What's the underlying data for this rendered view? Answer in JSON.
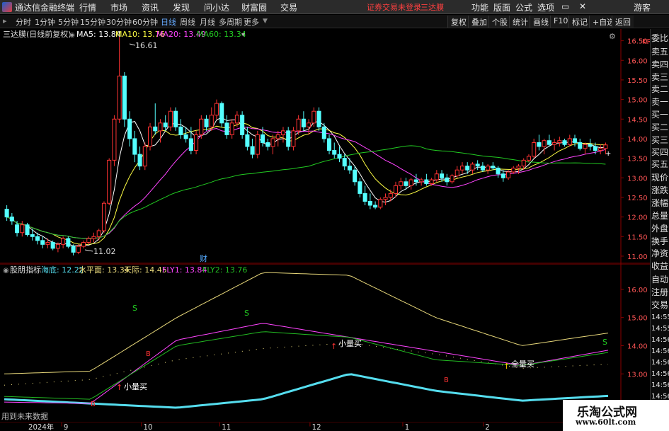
{
  "colors": {
    "up": "#ff3333",
    "down": "#55ffff",
    "ma5": "#ffffff",
    "ma10": "#ffff44",
    "ma20": "#ff44ff",
    "ma60": "#22cc22",
    "fly2": "#22bb22",
    "fly1": "#ff44ff",
    "ceiling": "#e8d87a",
    "floor": "#55ddee"
  },
  "topbar": {
    "app": "通达信金融终端",
    "menus": [
      "行情",
      "市场",
      "资讯",
      "发现",
      "问小达",
      "财富圈",
      "交易"
    ],
    "notice": "证券交易未登录",
    "stock": "三达膜",
    "right": [
      "功能",
      "版面",
      "公式",
      "选项"
    ],
    "guest": "游客"
  },
  "periods": {
    "items": [
      "分时",
      "1分钟",
      "5分钟",
      "15分钟",
      "30分钟",
      "60分钟",
      "日线",
      "周线",
      "月线",
      "多周期",
      "更多"
    ],
    "active": "日线",
    "right": [
      "复权",
      "叠加",
      "个股",
      "统计",
      "画线",
      "F10",
      "标记",
      "+自选",
      "返回"
    ]
  },
  "main": {
    "title": "三达膜(日线前复权)",
    "legend": [
      {
        "label": "MA5: 13.84",
        "key": "ma5"
      },
      {
        "label": "MA10: 13.76",
        "key": "ma10"
      },
      {
        "label": "MA20: 13.49",
        "key": "ma20"
      },
      {
        "label": "MA60: 13.34",
        "key": "ma60"
      }
    ],
    "max_label": "16.61",
    "min_label": "11.02",
    "cai_label": "财",
    "kr": "KR",
    "ticks": [
      "16.50",
      "16.00",
      "15.50",
      "15.00",
      "14.50",
      "14.00",
      "13.50",
      "13.00",
      "12.50",
      "12.00",
      "11.50",
      "11.00"
    ]
  },
  "indicator": {
    "title": "股朋指标",
    "legend": [
      {
        "label": "海底: 12.22",
        "key": "floor"
      },
      {
        "label": "水平面: 13.34",
        "key": "ceiling"
      },
      {
        "label": "天际: 14.45",
        "key": "ceiling"
      },
      {
        "label": "FLY1: 13.84",
        "key": "fly1"
      },
      {
        "label": "FLY2: 13.76",
        "key": "fly2"
      }
    ],
    "ticks": [
      "16.00",
      "15.00",
      "14.00",
      "13.00",
      "12.00"
    ],
    "annotations": [
      "S",
      "S",
      "S",
      "B",
      "B",
      "B",
      "小量买",
      "小量买",
      "全量买"
    ],
    "footer": "用到未来数据"
  },
  "side": [
    "委比",
    "卖五",
    "卖四",
    "卖三",
    "卖二",
    "卖一",
    "买一",
    "买二",
    "买三",
    "买四",
    "买五",
    "现价",
    "涨跌",
    "涨幅",
    "总量",
    "外盘",
    "换手",
    "净资",
    "收益"
  ],
  "side2": [
    "自动",
    "注册",
    "交易"
  ],
  "side_times": [
    "14:55",
    "14:55",
    "14:56",
    "14:56",
    "14:56",
    "14:56",
    "14:56",
    "14:56"
  ],
  "dates": [
    "2024年",
    "9",
    "10",
    "11",
    "12",
    "1",
    "2"
  ],
  "watermark": {
    "line1": "乐淘公式网",
    "line2": "www.60lt.com"
  },
  "chart_data": [
    {
      "type": "candlestick",
      "title": "三达膜(日线前复权)",
      "ylim": [
        10.8,
        16.8
      ],
      "x": [
        "2024-08-26",
        "2024-08-27",
        "2024-08-28",
        "2024-08-29",
        "2024-08-30",
        "2024-09-02",
        "2024-09-03",
        "2024-09-04",
        "2024-09-05",
        "2024-09-06",
        "2024-09-09",
        "2024-09-10",
        "2024-09-11",
        "2024-09-12",
        "2024-09-13",
        "2024-09-18",
        "2024-09-19",
        "2024-09-20",
        "2024-09-23",
        "2024-09-24",
        "2024-09-25",
        "2024-09-26",
        "2024-09-27",
        "2024-09-30",
        "2024-10-08",
        "2024-10-09",
        "2024-10-10",
        "2024-10-11",
        "2024-10-14",
        "2024-10-15",
        "2024-10-16",
        "2024-10-17",
        "2024-10-18",
        "2024-10-21",
        "2024-10-22",
        "2024-10-23",
        "2024-10-24",
        "2024-10-25",
        "2024-10-28",
        "2024-10-29",
        "2024-10-30",
        "2024-10-31",
        "2024-11-01",
        "2024-11-04",
        "2024-11-05",
        "2024-11-06",
        "2024-11-07",
        "2024-11-08",
        "2024-11-11",
        "2024-11-12",
        "2024-11-13",
        "2024-11-14",
        "2024-11-15",
        "2024-11-18",
        "2024-11-19",
        "2024-11-20",
        "2024-11-21",
        "2024-11-22",
        "2024-11-25",
        "2024-11-26",
        "2024-11-27",
        "2024-11-28",
        "2024-11-29",
        "2024-12-02",
        "2024-12-03",
        "2024-12-04",
        "2024-12-05",
        "2024-12-06",
        "2024-12-09",
        "2024-12-10",
        "2024-12-11",
        "2024-12-12",
        "2024-12-13",
        "2024-12-16",
        "2024-12-17",
        "2024-12-18",
        "2024-12-19",
        "2024-12-20",
        "2024-12-23",
        "2024-12-24",
        "2024-12-25",
        "2024-12-26",
        "2024-12-27",
        "2024-12-30",
        "2024-12-31",
        "2025-01-02",
        "2025-01-03",
        "2025-01-06",
        "2025-01-07",
        "2025-01-08",
        "2025-01-09",
        "2025-01-10",
        "2025-01-13",
        "2025-01-14",
        "2025-01-15",
        "2025-01-16",
        "2025-01-17",
        "2025-01-20",
        "2025-01-21",
        "2025-01-22",
        "2025-01-23",
        "2025-01-24",
        "2025-01-27",
        "2025-02-05",
        "2025-02-06",
        "2025-02-07",
        "2025-02-10",
        "2025-02-11",
        "2025-02-12",
        "2025-02-13",
        "2025-02-14",
        "2025-02-17",
        "2025-02-18",
        "2025-02-19",
        "2025-02-20",
        "2025-02-21",
        "2025-02-24",
        "2025-02-25",
        "2025-02-26",
        "2025-02-27",
        "2025-02-28"
      ],
      "ohlc": [
        [
          12.2,
          12.3,
          11.9,
          12.0
        ],
        [
          12.0,
          12.1,
          11.8,
          11.9
        ],
        [
          11.8,
          11.9,
          11.5,
          11.6
        ],
        [
          11.6,
          11.9,
          11.5,
          11.8
        ],
        [
          11.8,
          11.85,
          11.5,
          11.55
        ],
        [
          11.55,
          11.7,
          11.4,
          11.5
        ],
        [
          11.5,
          11.6,
          11.3,
          11.4
        ],
        [
          11.4,
          11.5,
          11.2,
          11.3
        ],
        [
          11.3,
          11.45,
          11.2,
          11.35
        ],
        [
          11.35,
          11.4,
          11.15,
          11.2
        ],
        [
          11.2,
          11.35,
          11.1,
          11.3
        ],
        [
          11.3,
          11.5,
          11.2,
          11.45
        ],
        [
          11.45,
          11.5,
          11.2,
          11.25
        ],
        [
          11.25,
          11.3,
          11.02,
          11.1
        ],
        [
          11.1,
          11.3,
          11.05,
          11.25
        ],
        [
          11.25,
          11.4,
          11.2,
          11.35
        ],
        [
          11.35,
          11.5,
          11.3,
          11.45
        ],
        [
          11.45,
          11.6,
          11.35,
          11.5
        ],
        [
          11.5,
          11.7,
          11.4,
          11.65
        ],
        [
          11.65,
          12.4,
          11.6,
          12.35
        ],
        [
          12.35,
          13.5,
          12.3,
          13.45
        ],
        [
          13.45,
          14.6,
          13.3,
          14.5
        ],
        [
          14.5,
          16.61,
          14.4,
          15.6
        ],
        [
          15.6,
          15.7,
          14.3,
          14.5
        ],
        [
          14.5,
          14.7,
          13.8,
          14.0
        ],
        [
          14.0,
          14.2,
          13.4,
          13.6
        ],
        [
          13.6,
          13.8,
          13.2,
          13.3
        ],
        [
          13.3,
          13.9,
          13.2,
          13.8
        ],
        [
          13.8,
          14.4,
          13.7,
          14.3
        ],
        [
          14.3,
          14.9,
          14.1,
          14.2
        ],
        [
          14.2,
          14.5,
          13.9,
          14.4
        ],
        [
          14.4,
          14.6,
          14.2,
          14.3
        ],
        [
          14.3,
          14.8,
          14.2,
          14.7
        ],
        [
          14.7,
          14.8,
          14.2,
          14.3
        ],
        [
          14.3,
          14.5,
          14.0,
          14.1
        ],
        [
          14.1,
          14.3,
          13.9,
          14.0
        ],
        [
          14.0,
          14.3,
          13.6,
          13.7
        ],
        [
          13.7,
          14.2,
          13.6,
          14.1
        ],
        [
          14.1,
          14.6,
          14.0,
          14.5
        ],
        [
          14.5,
          14.6,
          14.2,
          14.3
        ],
        [
          14.3,
          14.8,
          14.2,
          14.6
        ],
        [
          14.6,
          15.0,
          14.5,
          14.9
        ],
        [
          14.9,
          14.95,
          14.3,
          14.4
        ],
        [
          14.4,
          14.6,
          14.0,
          14.1
        ],
        [
          14.1,
          14.5,
          14.0,
          14.4
        ],
        [
          14.4,
          14.7,
          14.3,
          14.6
        ],
        [
          14.6,
          14.7,
          14.0,
          14.1
        ],
        [
          14.1,
          14.3,
          13.7,
          13.8
        ],
        [
          13.8,
          14.0,
          13.5,
          13.6
        ],
        [
          13.6,
          14.2,
          13.5,
          14.1
        ],
        [
          14.1,
          14.3,
          13.8,
          13.9
        ],
        [
          13.9,
          14.0,
          13.7,
          13.8
        ],
        [
          13.8,
          14.1,
          13.6,
          14.0
        ],
        [
          14.0,
          14.2,
          13.8,
          14.1
        ],
        [
          14.1,
          14.3,
          13.9,
          14.2
        ],
        [
          14.2,
          14.3,
          13.7,
          13.8
        ],
        [
          13.8,
          14.3,
          13.7,
          14.2
        ],
        [
          14.2,
          14.6,
          14.1,
          14.5
        ],
        [
          14.5,
          14.7,
          14.2,
          14.3
        ],
        [
          14.3,
          14.5,
          14.1,
          14.4
        ],
        [
          14.4,
          14.8,
          14.3,
          14.7
        ],
        [
          14.7,
          14.8,
          14.2,
          14.3
        ],
        [
          14.3,
          14.4,
          13.9,
          14.0
        ],
        [
          14.0,
          14.1,
          13.6,
          13.7
        ],
        [
          13.7,
          13.9,
          13.5,
          13.6
        ],
        [
          13.6,
          13.8,
          13.4,
          13.5
        ],
        [
          13.5,
          13.6,
          13.2,
          13.3
        ],
        [
          13.3,
          13.5,
          13.1,
          13.2
        ],
        [
          13.2,
          13.3,
          12.8,
          12.9
        ],
        [
          12.9,
          13.0,
          12.5,
          12.6
        ],
        [
          12.6,
          12.8,
          12.3,
          12.4
        ],
        [
          12.4,
          12.6,
          12.2,
          12.3
        ],
        [
          12.3,
          12.4,
          12.2,
          12.25
        ],
        [
          12.25,
          12.5,
          12.2,
          12.45
        ],
        [
          12.45,
          12.6,
          12.3,
          12.5
        ],
        [
          12.5,
          12.7,
          12.4,
          12.6
        ],
        [
          12.6,
          12.9,
          12.5,
          12.8
        ],
        [
          12.8,
          13.0,
          12.7,
          12.9
        ],
        [
          12.9,
          13.0,
          12.7,
          12.8
        ],
        [
          12.8,
          13.0,
          12.7,
          12.95
        ],
        [
          12.95,
          13.1,
          12.8,
          12.9
        ],
        [
          12.9,
          13.0,
          12.8,
          12.95
        ],
        [
          12.95,
          13.1,
          12.8,
          12.85
        ],
        [
          12.85,
          13.0,
          12.8,
          12.95
        ],
        [
          12.95,
          13.2,
          12.9,
          13.1
        ],
        [
          13.1,
          13.2,
          12.9,
          13.0
        ],
        [
          13.0,
          13.1,
          12.8,
          12.9
        ],
        [
          12.9,
          13.1,
          12.85,
          13.05
        ],
        [
          13.05,
          13.3,
          13.0,
          13.2
        ],
        [
          13.2,
          13.4,
          13.1,
          13.3
        ],
        [
          13.3,
          13.4,
          13.1,
          13.2
        ],
        [
          13.2,
          13.4,
          13.1,
          13.35
        ],
        [
          13.35,
          13.45,
          13.2,
          13.3
        ],
        [
          13.3,
          13.4,
          13.15,
          13.2
        ],
        [
          13.2,
          13.35,
          13.1,
          13.3
        ],
        [
          13.3,
          13.4,
          13.2,
          13.25
        ],
        [
          13.25,
          13.3,
          13.0,
          13.1
        ],
        [
          13.1,
          13.2,
          12.9,
          13.0
        ],
        [
          13.0,
          13.2,
          12.95,
          13.15
        ],
        [
          13.15,
          13.3,
          13.1,
          13.25
        ],
        [
          13.25,
          13.35,
          13.1,
          13.3
        ],
        [
          13.3,
          13.5,
          13.2,
          13.45
        ],
        [
          13.45,
          13.6,
          13.4,
          13.55
        ],
        [
          13.55,
          14.0,
          13.5,
          13.9
        ],
        [
          13.9,
          14.1,
          13.7,
          13.8
        ],
        [
          13.8,
          14.0,
          13.6,
          13.95
        ],
        [
          13.95,
          14.1,
          13.8,
          13.85
        ],
        [
          13.85,
          14.0,
          13.7,
          13.9
        ],
        [
          13.9,
          14.05,
          13.8,
          13.95
        ],
        [
          13.95,
          14.0,
          13.8,
          13.85
        ],
        [
          13.85,
          14.1,
          13.8,
          14.0
        ],
        [
          14.0,
          14.1,
          13.8,
          13.9
        ],
        [
          13.9,
          14.0,
          13.7,
          13.75
        ],
        [
          13.75,
          13.9,
          13.6,
          13.85
        ],
        [
          13.85,
          14.0,
          13.7,
          13.8
        ],
        [
          13.8,
          13.9,
          13.6,
          13.7
        ],
        [
          13.7,
          13.85,
          13.6,
          13.75
        ],
        [
          13.75,
          13.9,
          13.6,
          13.84
        ]
      ],
      "series": [
        {
          "name": "MA5",
          "last": 13.84
        },
        {
          "name": "MA10",
          "last": 13.76
        },
        {
          "name": "MA20",
          "last": 13.49
        },
        {
          "name": "MA60",
          "last": 13.34
        }
      ]
    },
    {
      "type": "line",
      "title": "股朋指标",
      "ylim": [
        11.3,
        16.9
      ],
      "x": [
        "2024-08",
        "2024-09",
        "2024-10",
        "2024-11",
        "2024-12",
        "2025-01",
        "2025-02"
      ],
      "series": [
        {
          "name": "海底",
          "values": [
            12.1,
            11.95,
            11.8,
            12.1,
            13.0,
            12.4,
            12.05,
            12.22
          ]
        },
        {
          "name": "水平面",
          "values": [
            12.6,
            12.8,
            13.5,
            13.9,
            14.1,
            13.7,
            13.2,
            13.34
          ]
        },
        {
          "name": "天际",
          "values": [
            13.0,
            13.1,
            15.0,
            16.6,
            16.5,
            15.0,
            14.0,
            14.45
          ]
        },
        {
          "name": "FLY1",
          "values": [
            12.0,
            11.95,
            14.2,
            14.8,
            14.3,
            13.8,
            13.3,
            13.84
          ]
        },
        {
          "name": "FLY2",
          "values": [
            12.2,
            12.1,
            14.0,
            14.5,
            14.3,
            13.5,
            13.3,
            13.76
          ]
        }
      ]
    }
  ]
}
